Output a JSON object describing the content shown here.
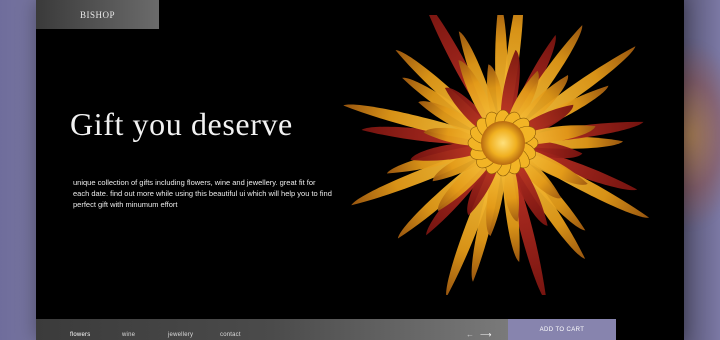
{
  "brand": {
    "name": "BISHOP"
  },
  "hero": {
    "headline": "Gift you deserve",
    "description": "unique collection of gifts including flowers, wine and jewellery. great fit for each date. find out more while using this beautiful ui which will help you to find perfect gift with minumum effort"
  },
  "nav": {
    "items": [
      {
        "label": "flowers",
        "active": true
      },
      {
        "label": "wine",
        "active": false
      },
      {
        "label": "jewellery",
        "active": false
      },
      {
        "label": "contact",
        "active": false
      }
    ],
    "prev_icon": "arrow-left-icon",
    "next_icon": "arrow-right-icon"
  },
  "cta": {
    "label": "ADD TO CART"
  },
  "colors": {
    "background": "#6e6c9a",
    "card": "#000000",
    "accent": "#8784ae"
  }
}
